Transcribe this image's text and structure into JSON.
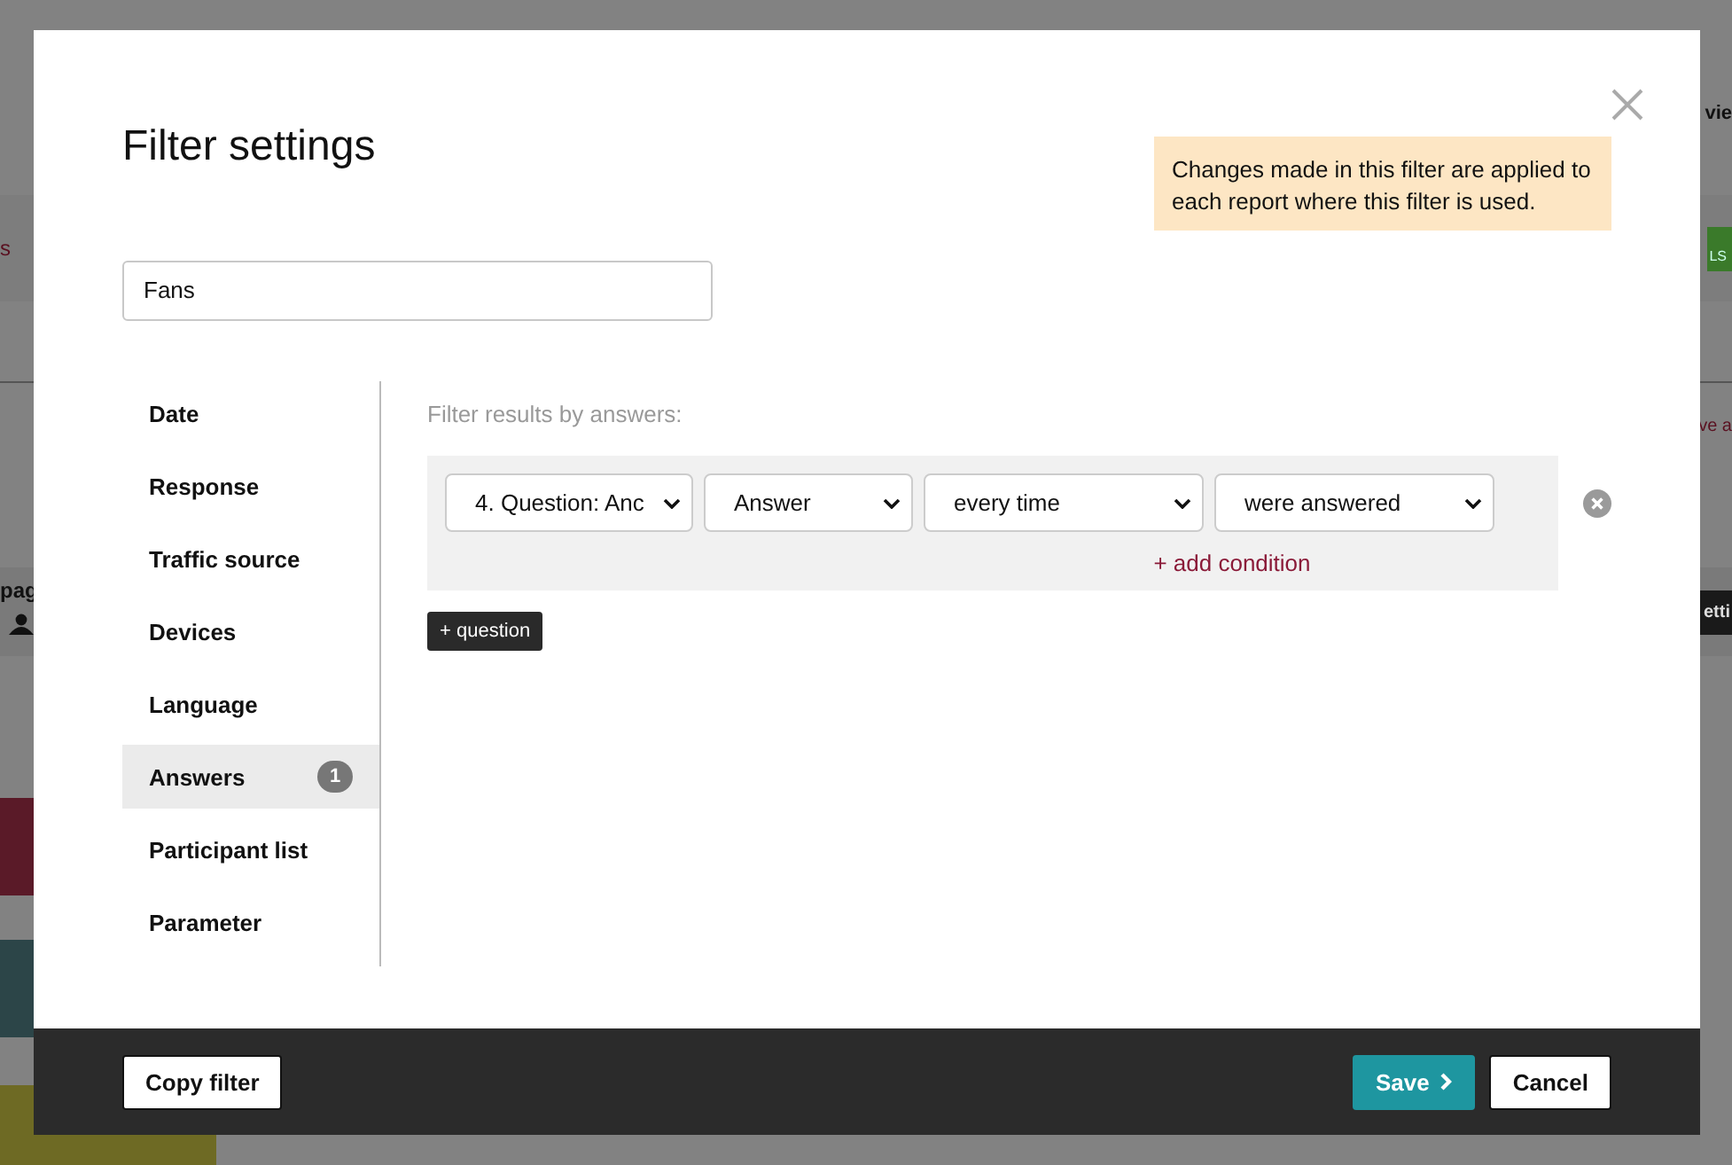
{
  "background": {
    "fragments": [
      {
        "kind": "bold",
        "text": "vie"
      },
      {
        "kind": "link",
        "text": "s"
      },
      {
        "kind": "file",
        "text": "LS"
      },
      {
        "kind": "link",
        "text": "ve a"
      },
      {
        "kind": "bold",
        "text": "pag"
      },
      {
        "kind": "dark",
        "text": "etti"
      }
    ]
  },
  "dialog": {
    "title": "Filter settings",
    "notice": "Changes made in this filter are applied to each report where this filter is used.",
    "name_field": {
      "value": "Fans"
    },
    "categories": [
      {
        "label": "Date",
        "selected": false
      },
      {
        "label": "Response",
        "selected": false
      },
      {
        "label": "Traffic source",
        "selected": false
      },
      {
        "label": "Devices",
        "selected": false
      },
      {
        "label": "Language",
        "selected": false
      },
      {
        "label": "Answers",
        "selected": true,
        "badge": "1"
      },
      {
        "label": "Participant list",
        "selected": false
      },
      {
        "label": "Parameter",
        "selected": false
      }
    ],
    "panel": {
      "heading": "Filter results by answers:",
      "conditions": [
        {
          "selects": [
            "4. Question: Anc",
            "Answer",
            "every time",
            "were answered"
          ],
          "add_condition": "+ add condition"
        }
      ],
      "add_question": "+ question"
    },
    "footer": {
      "copy": "Copy filter",
      "save": "Save",
      "cancel": "Cancel"
    }
  }
}
